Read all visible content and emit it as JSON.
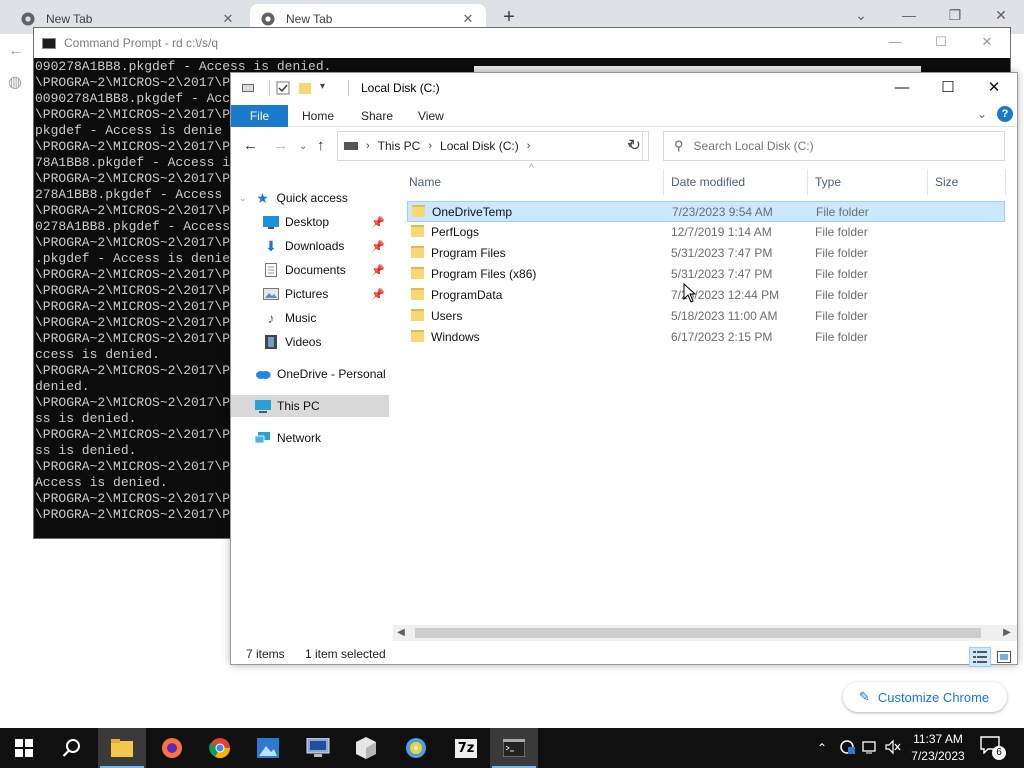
{
  "chrome": {
    "tabs": [
      {
        "label": "New Tab"
      },
      {
        "label": "New Tab"
      }
    ],
    "customize_label": "Customize Chrome"
  },
  "cmd": {
    "title": "Command Prompt - rd  c:\\/s/q",
    "lines": [
      "090278A1BB8.pkgdef - Access is denied.",
      "\\PROGRA~2\\MICROS~2\\2017\\P",
      "0090278A1BB8.pkgdef - Acc",
      "\\PROGRA~2\\MICROS~2\\2017\\P",
      "pkgdef - Access is denie",
      "\\PROGRA~2\\MICROS~2\\2017\\P",
      "78A1BB8.pkgdef - Access i",
      "\\PROGRA~2\\MICROS~2\\2017\\P",
      "278A1BB8.pkgdef - Access",
      "\\PROGRA~2\\MICROS~2\\2017\\P",
      "0278A1BB8.pkgdef - Access",
      "\\PROGRA~2\\MICROS~2\\2017\\P",
      ".pkgdef - Access is denie",
      "\\PROGRA~2\\MICROS~2\\2017\\P",
      "\\PROGRA~2\\MICROS~2\\2017\\P",
      "\\PROGRA~2\\MICROS~2\\2017\\P",
      "\\PROGRA~2\\MICROS~2\\2017\\P",
      "\\PROGRA~2\\MICROS~2\\2017\\P",
      "ccess is denied.",
      "\\PROGRA~2\\MICROS~2\\2017\\P",
      "denied.",
      "\\PROGRA~2\\MICROS~2\\2017\\P",
      "ss is denied.",
      "\\PROGRA~2\\MICROS~2\\2017\\P",
      "ss is denied.",
      "\\PROGRA~2\\MICROS~2\\2017\\P",
      "Access is denied.",
      "\\PROGRA~2\\MICROS~2\\2017\\P",
      "\\PROGRA~2\\MICROS~2\\2017\\P"
    ]
  },
  "explorer": {
    "title": "Local Disk (C:)",
    "ribbon": {
      "file": "File",
      "home": "Home",
      "share": "Share",
      "view": "View",
      "help": "?"
    },
    "breadcrumb": [
      "This PC",
      "Local Disk (C:)"
    ],
    "search_placeholder": "Search Local Disk (C:)",
    "nav": {
      "quick_access": "Quick access",
      "desktop": "Desktop",
      "downloads": "Downloads",
      "documents": "Documents",
      "pictures": "Pictures",
      "music": "Music",
      "videos": "Videos",
      "onedrive": "OneDrive - Personal",
      "thispc": "This PC",
      "network": "Network"
    },
    "columns": {
      "name": "Name",
      "date": "Date modified",
      "type": "Type",
      "size": "Size"
    },
    "files": [
      {
        "name": "OneDriveTemp",
        "date": "7/23/2023 9:54 AM",
        "type": "File folder"
      },
      {
        "name": "PerfLogs",
        "date": "12/7/2019 1:14 AM",
        "type": "File folder"
      },
      {
        "name": "Program Files",
        "date": "5/31/2023 7:47 PM",
        "type": "File folder"
      },
      {
        "name": "Program Files (x86)",
        "date": "5/31/2023 7:47 PM",
        "type": "File folder"
      },
      {
        "name": "ProgramData",
        "date": "7/23/2023 12:44 PM",
        "type": "File folder"
      },
      {
        "name": "Users",
        "date": "5/18/2023 11:00 AM",
        "type": "File folder"
      },
      {
        "name": "Windows",
        "date": "6/17/2023 2:15 PM",
        "type": "File folder"
      }
    ],
    "status": {
      "count": "7 items",
      "selected": "1 item selected"
    }
  },
  "taskbar": {
    "time": "11:37 AM",
    "date": "7/23/2023",
    "notif_count": "6",
    "zip_label": "7z"
  },
  "colors": {
    "accent": "#1979ca",
    "selection": "#cce8ff",
    "folder": "#f8d775",
    "taskbar": "#101010"
  }
}
